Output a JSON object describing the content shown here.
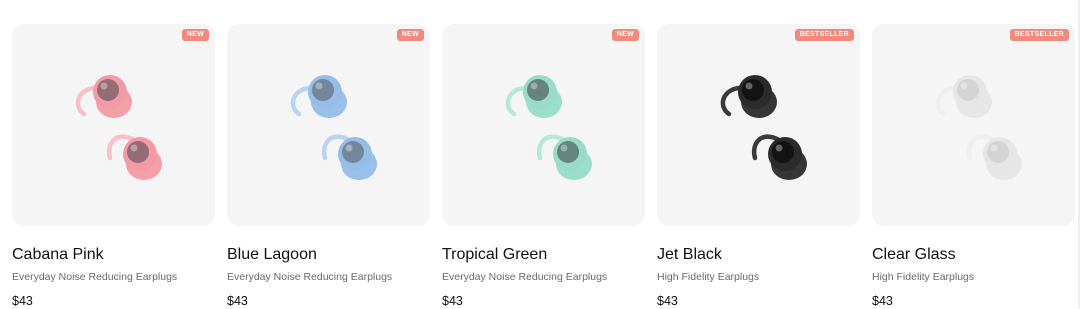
{
  "products": [
    {
      "name": "Cabana Pink",
      "subtitle": "Everyday Noise Reducing Earplugs",
      "price": "$43",
      "badge": "NEW",
      "icon": "earplug-pair-image",
      "colors": {
        "body": "#f29aa5",
        "mesh": "#8a6770",
        "loop": "#f8c0c7"
      }
    },
    {
      "name": "Blue Lagoon",
      "subtitle": "Everyday Noise Reducing Earplugs",
      "price": "$43",
      "badge": "NEW",
      "icon": "earplug-pair-image",
      "colors": {
        "body": "#95bde8",
        "mesh": "#6f7f93",
        "loop": "#b9d4f2"
      }
    },
    {
      "name": "Tropical Green",
      "subtitle": "Everyday Noise Reducing Earplugs",
      "price": "$43",
      "badge": "NEW",
      "icon": "earplug-pair-image",
      "colors": {
        "body": "#98dcc8",
        "mesh": "#5f7a74",
        "loop": "#b6e8d8"
      }
    },
    {
      "name": "Jet Black",
      "subtitle": "High Fidelity Earplugs",
      "price": "$43",
      "badge": "BESTSELLER",
      "icon": "earplug-pair-image",
      "colors": {
        "body": "#2b2b2b",
        "mesh": "#111111",
        "loop": "#3a3a3a"
      }
    },
    {
      "name": "Clear Glass",
      "subtitle": "High Fidelity Earplugs",
      "price": "$43",
      "badge": "BESTSELLER",
      "icon": "earplug-pair-image",
      "colors": {
        "body": "#e6e6e6",
        "mesh": "#d2d2d2",
        "loop": "#efefef"
      }
    }
  ],
  "theme": {
    "badge_color": "#f08a7f",
    "tile_color": "#f5f5f5"
  }
}
